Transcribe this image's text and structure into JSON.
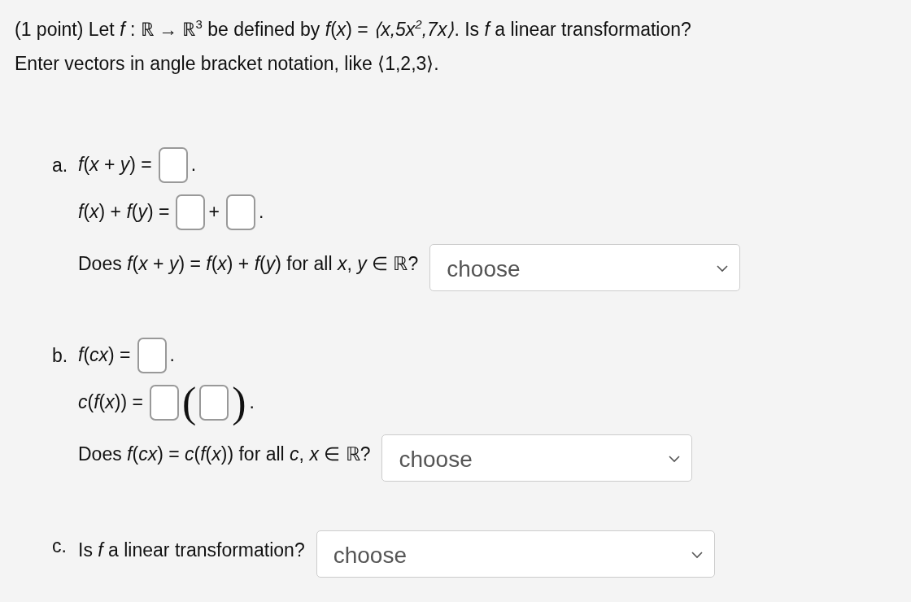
{
  "intro": "(1 point) Let *f* : ℝ → ℝ$^{3}$ be defined by *f*(*x*) = *⟨x,5x$^{2}$,7x⟩*. Is *f* a linear transformation?",
  "instruction": "Enter vectors in angle bracket notation, like ⟨1,2,3⟩.",
  "parts": [
    {
      "label": "a.",
      "lines": [
        [
          {
            "kind": "text",
            "text": "*f*(*x* + *y*) ="
          },
          {
            "kind": "blank"
          },
          {
            "kind": "text",
            "text": "."
          }
        ],
        [
          {
            "kind": "text",
            "text": "*f*(*x*) + *f*(*y*) ="
          },
          {
            "kind": "blank"
          },
          {
            "kind": "text",
            "text": "+"
          },
          {
            "kind": "blank"
          },
          {
            "kind": "text",
            "text": "."
          }
        ],
        [
          {
            "kind": "text",
            "text": "Does *f*(*x* + *y*) = *f*(*x*) + *f*(*y*) for all *x*, *y* ∈ ℝ?"
          },
          {
            "kind": "select",
            "value": "choose"
          }
        ]
      ]
    },
    {
      "label": "b.",
      "lines": [
        [
          {
            "kind": "text",
            "text": "*f*(*cx*) ="
          },
          {
            "kind": "blank"
          },
          {
            "kind": "text",
            "text": "."
          }
        ],
        [
          {
            "kind": "text",
            "text": "*c*(*f*(*x*)) ="
          },
          {
            "kind": "blank"
          },
          {
            "kind": "paren",
            "text": "("
          },
          {
            "kind": "blank"
          },
          {
            "kind": "paren",
            "text": ")"
          },
          {
            "kind": "text",
            "text": "."
          }
        ],
        [
          {
            "kind": "text",
            "text": "Does *f*(*cx*) = *c*(*f*(*x*)) for all *c*, *x* ∈ ℝ?"
          },
          {
            "kind": "select",
            "value": "choose"
          }
        ]
      ]
    },
    {
      "label": "c.",
      "lines": [
        [
          {
            "kind": "text",
            "text": "Is *f* a linear transformation?"
          },
          {
            "kind": "select",
            "value": "choose"
          }
        ]
      ]
    }
  ]
}
